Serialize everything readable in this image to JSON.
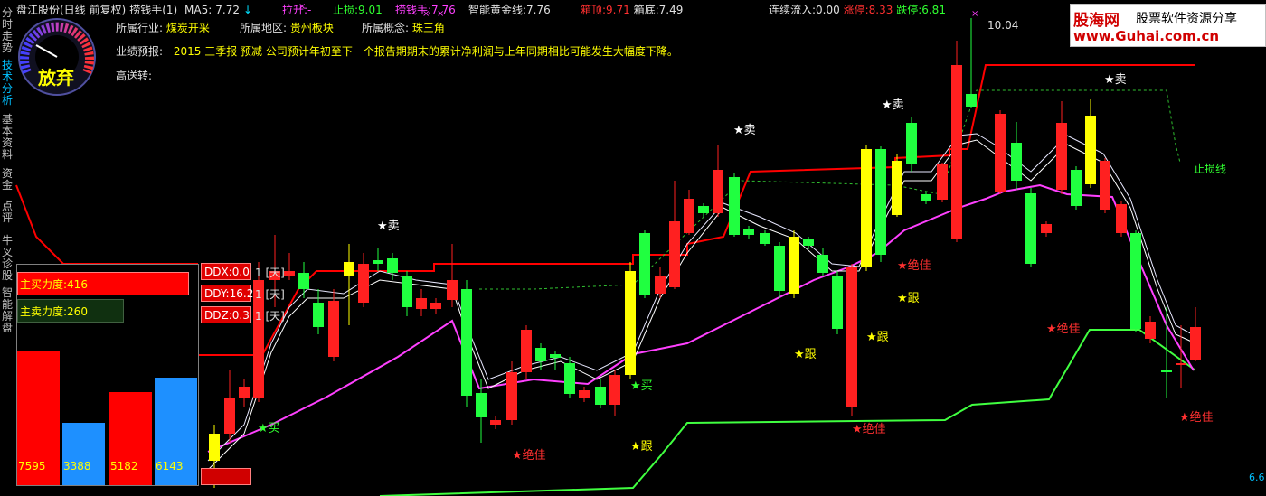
{
  "header": {
    "stock": "盘江股份(日线 前复权)",
    "indicator": "捞钱手(1)",
    "ma5_label": "MA5:",
    "ma5_value": "7.72",
    "ma5_arrow": "↓",
    "lasheng_label": "拉升:",
    "lasheng_value": "-",
    "zhisun_label": "止损:",
    "zhisun_value": "9.01",
    "laoqianshou_label": "捞钱手:",
    "laoqianshou_value": "7.76",
    "gold_label": "智能黄金线:",
    "gold_value": "7.76",
    "box_top_label": "箱顶:",
    "box_top_value": "9.71",
    "box_bottom_label": "箱底:",
    "box_bottom_value": "7.49",
    "inflow_label": "连续流入:",
    "inflow_value": "0.00",
    "limit_up_label": "涨停:",
    "limit_up_value": "8.33",
    "limit_down_label": "跌停:",
    "limit_down_value": "6.81"
  },
  "info": {
    "industry_label": "所属行业:",
    "industry_value": "煤炭开采",
    "region_label": "所属地区:",
    "region_value": "贵州板块",
    "concept_label": "所属概念:",
    "concept_value": "珠三角",
    "forecast_label": "业绩预报:",
    "forecast_value": "2015 三季报 预减 公司预计年初至下一个报告期期末的累计净利润与上年同期相比可能发生大幅度下降。",
    "transfer_label": "高送转:"
  },
  "sidebar": {
    "tabs": [
      "分时走势",
      "技术分析",
      "基本资料",
      "资金",
      "点评",
      "牛叉诊股",
      "智能解盘"
    ],
    "active": 1
  },
  "dial": {
    "label": "放弃"
  },
  "force": {
    "buy_label": "主买力度:416",
    "sell_label": "主卖力度:260",
    "bars": [
      {
        "value": "7595",
        "color": "#ff0000",
        "height": 0.62
      },
      {
        "value": "3388",
        "color": "#1e90ff",
        "height": 0.29
      },
      {
        "value": "5182",
        "color": "#ff0000",
        "height": 0.43
      },
      {
        "value": "6143",
        "color": "#1e90ff",
        "height": 0.5
      }
    ]
  },
  "ddx": [
    {
      "label": "DDX:0.0",
      "unit": "1 [天]"
    },
    {
      "label": "DDY:16.2",
      "unit": "1 [天]"
    },
    {
      "label": "DDZ:0.3",
      "unit": "1 [天]"
    }
  ],
  "signals": {
    "sell": "卖",
    "buy": "买",
    "follow": "跟",
    "best": "绝佳",
    "stop_line": "止损线"
  },
  "price_labels": {
    "high": "10.04",
    "low": "6.6"
  },
  "logo": {
    "title": "股海网",
    "subtitle": "股票软件资源分享",
    "url": "www.Guhai.com.cn"
  },
  "colors": {
    "up": "#ff2020",
    "down": "#20ff40",
    "gold": "#ffff00",
    "ma": "#ff40ff",
    "stop": "#ff0000",
    "support": "#40ff40"
  }
}
